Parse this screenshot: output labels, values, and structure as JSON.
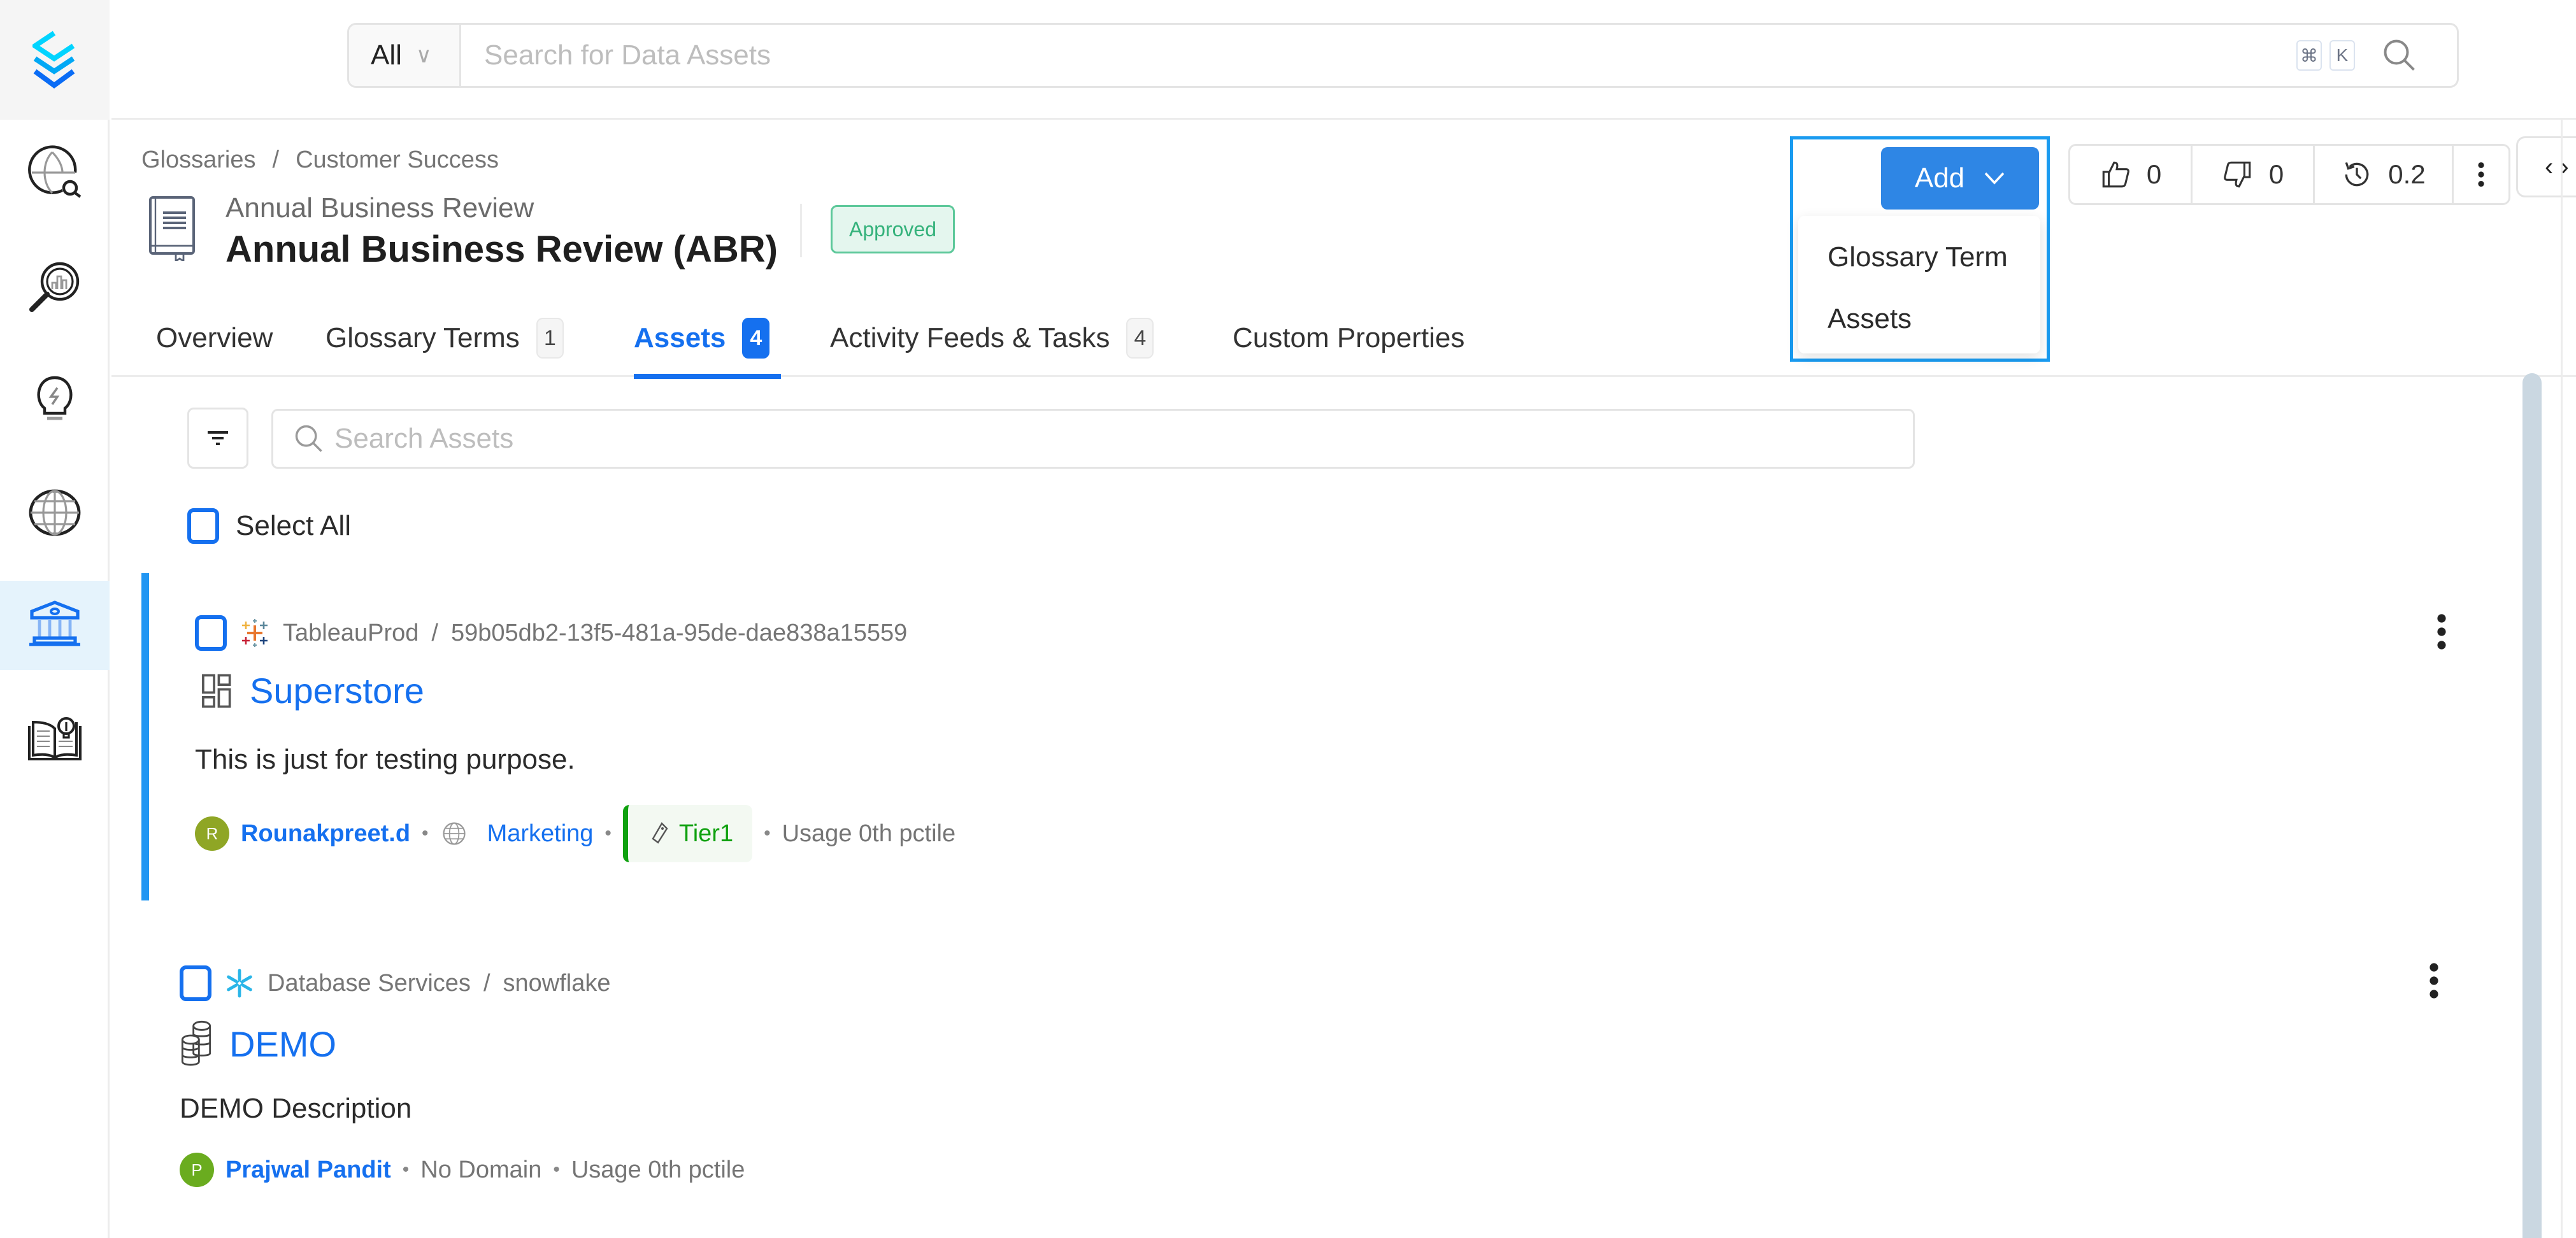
{
  "sidebar": {
    "logo": "openmetadata-logo-icon",
    "items": [
      {
        "name": "explore",
        "icon": "globe-search-icon",
        "active": false
      },
      {
        "name": "observability",
        "icon": "magnifier-chart-icon",
        "active": false
      },
      {
        "name": "insights",
        "icon": "lightbulb-icon",
        "active": false
      },
      {
        "name": "domains",
        "icon": "globe-icon",
        "active": false
      },
      {
        "name": "governance",
        "icon": "bank-icon",
        "active": true
      },
      {
        "name": "knowledge",
        "icon": "book-lightbulb-icon",
        "active": false
      }
    ]
  },
  "topbar": {
    "scope": "All",
    "search_placeholder": "Search for Data Assets",
    "shortcut_keys": [
      "⌘",
      "K"
    ]
  },
  "header": {
    "breadcrumb": [
      "Glossaries",
      "Customer Success"
    ],
    "breadcrumb_sep": "/",
    "subtitle": "Annual Business Review",
    "title": "Annual Business Review (ABR)",
    "status": "Approved"
  },
  "tabs": [
    {
      "label": "Overview",
      "count": null,
      "active": false
    },
    {
      "label": "Glossary Terms",
      "count": "1",
      "active": false
    },
    {
      "label": "Assets",
      "count": "4",
      "active": true
    },
    {
      "label": "Activity Feeds & Tasks",
      "count": "4",
      "active": false
    },
    {
      "label": "Custom Properties",
      "count": null,
      "active": false
    }
  ],
  "add_menu": {
    "button_label": "Add",
    "items": [
      "Glossary Term",
      "Assets"
    ]
  },
  "votes": {
    "up": "0",
    "down": "0",
    "version": "0.2"
  },
  "assets": {
    "search_placeholder": "Search Assets",
    "select_all_label": "Select All",
    "items": [
      {
        "service": "TableauProd",
        "path": "59b05db2-13f5-481a-95de-dae838a15559",
        "name": "Superstore",
        "description": "This is just for testing purpose.",
        "owner": "Rounakpreet.d",
        "owner_initial": "R",
        "owner_color": "#8fa625",
        "domain": "Marketing",
        "tier": "Tier1",
        "usage": "Usage 0th pctile"
      },
      {
        "service": "Database Services",
        "path": "snowflake",
        "name": "DEMO",
        "description": "DEMO Description",
        "owner": "Prajwal Pandit",
        "owner_initial": "P",
        "owner_color": "#6aac1f",
        "domain": "No Domain",
        "usage": "Usage 0th pctile"
      }
    ]
  },
  "colors": {
    "primary": "#1570ef",
    "add_button": "#2e86e5",
    "approved": "#34b27b",
    "tier": "#0fa10f",
    "selected_border": "#2196f3"
  }
}
